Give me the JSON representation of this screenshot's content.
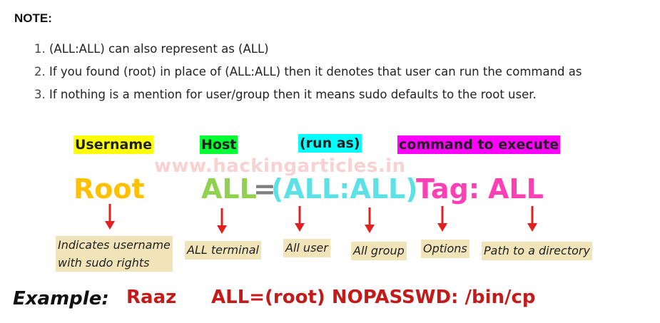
{
  "note": {
    "title": "NOTE:",
    "items": [
      {
        "num": "1.",
        "text": "(ALL:ALL) can also represent as (ALL)"
      },
      {
        "num": "2.",
        "text": "If you found (root) in place of (ALL:ALL) then it denotes that user can run the command as"
      },
      {
        "num": "3.",
        "text": "If nothing is a mention for user/group then it means sudo defaults to the root user."
      }
    ]
  },
  "labels": {
    "username": "Username",
    "host": "Host",
    "run_as": "(run as)",
    "command": "command to execute"
  },
  "watermark": "www.hackingarticles.in",
  "syntax": {
    "user": "Root",
    "host": "ALL",
    "equals": "=",
    "run_as": "(ALL:ALL)",
    "tag": "Tag:",
    "command": "ALL"
  },
  "descriptions": {
    "username": "Indicates username",
    "username_line2": "with sudo rights",
    "terminal": "ALL terminal",
    "user": "All user",
    "group": "All group",
    "options": "Options",
    "path": "Path to a directory"
  },
  "example": {
    "label": "Example:",
    "user": "Raaz",
    "command": "ALL=(root) NOPASSWD: /bin/cp"
  },
  "colors": {
    "username_bg": "#ffff00",
    "host_bg": "#00ff33",
    "run_as_bg": "#00ffff",
    "command_bg": "#ff00ff",
    "root_text": "#ffc000",
    "all_text": "#92d050",
    "equals_text": "#7f7f7f",
    "run_as_text": "#5ce1e6",
    "tag_text": "#ff3fb4",
    "arrow": "#e32020",
    "desc_bg": "#f1e4b8",
    "example_red": "#c41a1a"
  }
}
